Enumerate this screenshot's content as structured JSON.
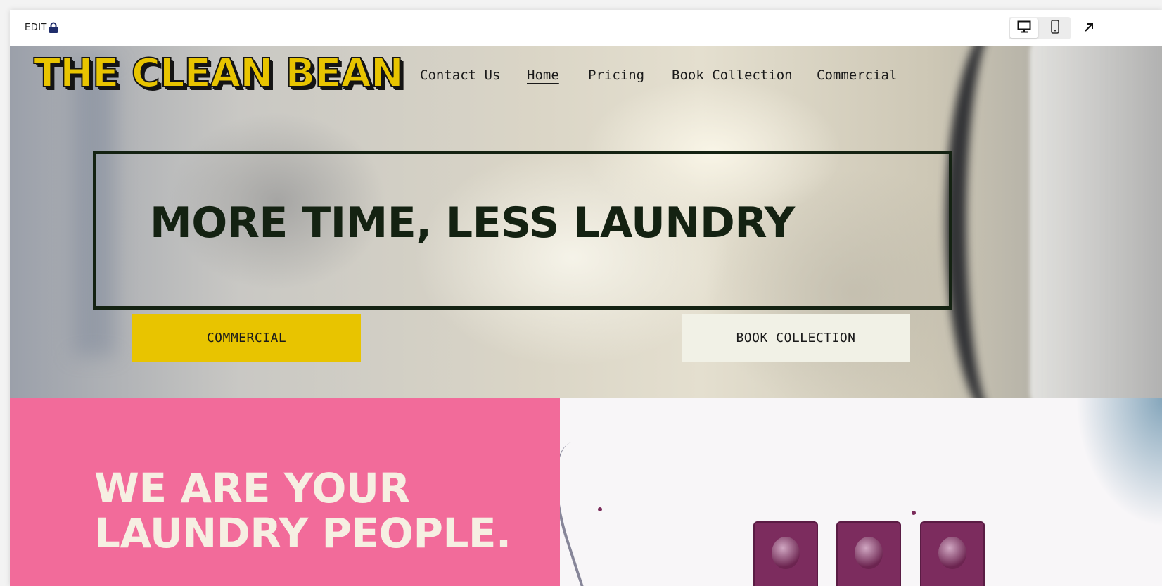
{
  "editor": {
    "edit_label": "EDIT",
    "lock_icon": "lock-icon",
    "desktop_icon": "desktop-icon",
    "mobile_icon": "mobile-icon",
    "expand_icon": "arrow-up-right-icon"
  },
  "site": {
    "logo": "THE CLEAN BEAN",
    "nav": [
      {
        "label": "Contact Us",
        "active": false
      },
      {
        "label": "Home",
        "active": true
      },
      {
        "label": "Pricing",
        "active": false
      },
      {
        "label": "Book Collection",
        "active": false
      },
      {
        "label": "Commercial",
        "active": false
      }
    ]
  },
  "hero": {
    "headline": "MORE TIME, LESS LAUNDRY",
    "primary_button": "COMMERCIAL",
    "secondary_button": "BOOK COLLECTION"
  },
  "about": {
    "title_line1": "WE ARE YOUR",
    "title_line2": "LAUNDRY PEOPLE."
  },
  "colors": {
    "accent_yellow": "#e8c400",
    "pink": "#f26b9a",
    "dark_green": "#142212",
    "cream": "#f6efe2"
  }
}
